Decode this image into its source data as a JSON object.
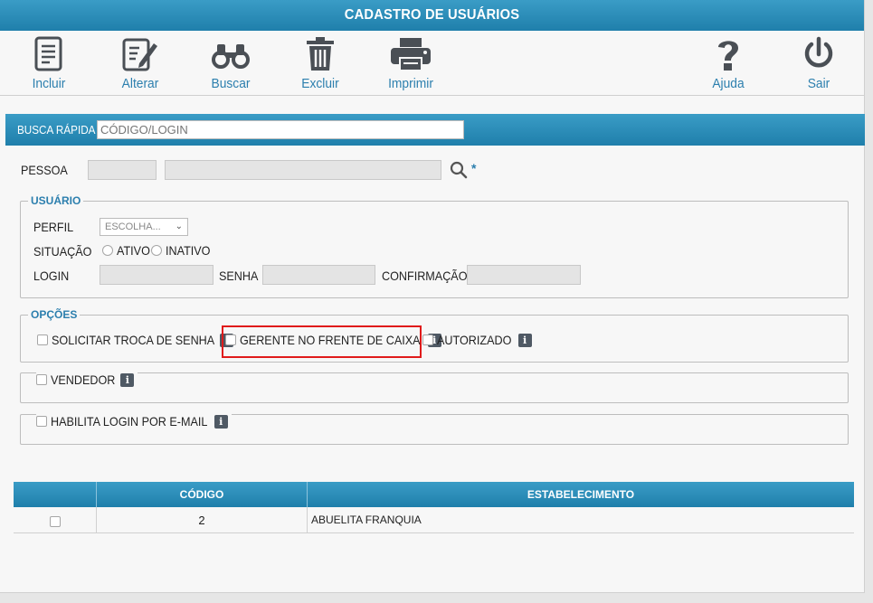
{
  "window": {
    "title": "CADASTRO DE USUÁRIOS"
  },
  "toolbar": {
    "incluir": "Incluir",
    "alterar": "Alterar",
    "buscar": "Buscar",
    "excluir": "Excluir",
    "imprimir": "Imprimir",
    "ajuda": "Ajuda",
    "sair": "Sair"
  },
  "quick_search": {
    "label": "BUSCA RÁPIDA",
    "placeholder": "CÓDIGO/LOGIN"
  },
  "pessoa": {
    "label": "PESSOA",
    "required": "*"
  },
  "usuario": {
    "legend": "USUÁRIO",
    "perfil_label": "PERFIL",
    "perfil_value": "ESCOLHA...",
    "situacao_label": "SITUAÇÃO",
    "ativo": "ATIVO",
    "inativo": "INATIVO",
    "login_label": "LOGIN",
    "senha_label": "SENHA",
    "confirmacao_label": "CONFIRMAÇÃO"
  },
  "opcoes": {
    "legend": "OPÇÕES",
    "solicitar": "SOLICITAR TROCA DE SENHA",
    "gerente": "GERENTE NO FRENTE DE CAIXA",
    "autorizado": "AUTORIZADO"
  },
  "vendedor": {
    "label": "VENDEDOR"
  },
  "habilita": {
    "label": "HABILITA LOGIN POR E-MAIL"
  },
  "info_glyph": "i",
  "table": {
    "headers": [
      "",
      "CÓDIGO",
      "ESTABELECIMENTO"
    ],
    "rows": [
      {
        "codigo": "2",
        "estabelecimento": "ABUELITA FRANQUIA"
      }
    ]
  },
  "colors": {
    "accent": "#2c7fae",
    "header": "#1f7fab",
    "highlight": "#e01b1b"
  }
}
